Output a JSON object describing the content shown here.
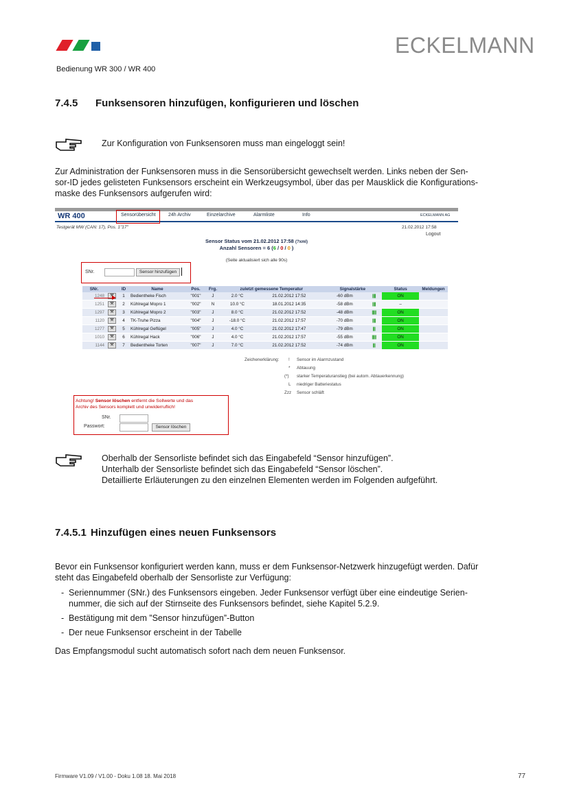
{
  "header": {
    "brand": "ECKELMANN",
    "subtitle": "Bedienung WR 300 / WR 400",
    "logo_colors": [
      "#e0202a",
      "#18a040",
      "#2060a8"
    ]
  },
  "section": {
    "number": "7.4.5",
    "title": "Funksensoren hinzufügen, konfigurieren und löschen"
  },
  "note1": "Zur Konfiguration von Funksensoren muss man eingeloggt sein!",
  "intro": [
    "Zur Administration der Funksensoren muss in die Sensorübersicht gewechselt werden. Links neben der Sen-",
    "sor-ID jedes gelisteten Funksensors erscheint ein Werkzeugsymbol, über das per Mausklick die Konfigurations-",
    "maske des Funksensors aufgerufen wird:"
  ],
  "screenshot": {
    "app": "WR 400",
    "nav": [
      "Sensorübersicht",
      "24h Archiv",
      "Einzelarchive",
      "Alarmliste",
      "Info"
    ],
    "company": "ECKELMANN AG",
    "device": "Testgerät MW (CAN: 17), Pos. 1\"17\"",
    "datetime": "21.02.2012 17:58",
    "logout": "Logout",
    "status_title": "Sensor Status vom 21.02.2012 17:58",
    "xml_link": "(?xml)",
    "count_label": "Anzahl Sensoren = 6 (",
    "count_green": "6",
    "count_sep1": " / ",
    "count_red": "0",
    "count_sep2": " / ",
    "count_orange": "0",
    "count_end": " )",
    "refresh_note": "(Seite aktualisiert sich alle 90s)",
    "add": {
      "label": "SNr.",
      "button": "Sensor hinzufügen"
    },
    "columns": [
      "SNr.",
      "ID",
      "Name",
      "Pos.",
      "Frg.",
      "zuletzt gemessene Temperatur",
      "",
      "Signalstärke",
      "",
      "Status",
      "Meldungen"
    ],
    "rows": [
      {
        "snr": "1248",
        "id": "1",
        "name": "Bedientheke Fisch",
        "pos": "\"001\"",
        "frg": "J",
        "temp": "2.0 °C",
        "time": "21.02.2012 17:52",
        "signal": "-60 dBm",
        "bars": "||||",
        "status": "ON"
      },
      {
        "snr": "1251",
        "id": "2",
        "name": "Kühlregal Mopro 1",
        "pos": "\"002\"",
        "frg": "N",
        "temp": "10.0 °C",
        "time": "18.01.2012 14:35",
        "signal": "-58 dBm",
        "bars": "||||",
        "status": "–"
      },
      {
        "snr": "1297",
        "id": "3",
        "name": "Kühlregal Mopro 2",
        "pos": "\"003\"",
        "frg": "J",
        "temp": "8.0 °C",
        "time": "21.02.2012 17:52",
        "signal": "-48 dBm",
        "bars": "|||||",
        "status": "ON"
      },
      {
        "snr": "1120",
        "id": "4",
        "name": "TK-Truhe Pizza",
        "pos": "\"004\"",
        "frg": "J",
        "temp": "-18.0 °C",
        "time": "21.02.2012 17:57",
        "signal": "-70 dBm",
        "bars": "||||",
        "status": "ON"
      },
      {
        "snr": "1277",
        "id": "5",
        "name": "Kühlregal Geflügel",
        "pos": "\"005\"",
        "frg": "J",
        "temp": "4.0 °C",
        "time": "21.02.2012 17:47",
        "signal": "-79 dBm",
        "bars": "|||",
        "status": "ON"
      },
      {
        "snr": "1010",
        "id": "6",
        "name": "Kühlregal Hack",
        "pos": "\"006\"",
        "frg": "J",
        "temp": "4.0 °C",
        "time": "21.02.2012 17:57",
        "signal": "-55 dBm",
        "bars": "|||||",
        "status": "ON"
      },
      {
        "snr": "1144",
        "id": "7",
        "name": "Bedientheke Torten",
        "pos": "\"007\"",
        "frg": "J",
        "temp": "7.0 °C",
        "time": "21.02.2012 17:52",
        "signal": "-74 dBm",
        "bars": "|||",
        "status": "ON"
      }
    ],
    "legend_title": "Zeichenerklärung:",
    "legend": [
      {
        "sym": "!",
        "text": "Sensor im Alarmzustand"
      },
      {
        "sym": "*",
        "text": "Abtauung"
      },
      {
        "sym": "(*)",
        "text": "starker Temperaturanstieg (bei autom. Abtauerkennung)"
      },
      {
        "sym": "L",
        "text": "niedriger Batteriestatus"
      },
      {
        "sym": "Zzz",
        "text": "Sensor schläft"
      }
    ],
    "delete": {
      "warn_pre": "Achtung! ",
      "warn_bold": "Sensor löschen",
      "warn_post": " entfernt die Sollwerte und das",
      "warn_line2": "Archiv des Sensors komplett und unwiderruflich!",
      "snr_label": "SNr.",
      "pw_label": "Passwort:",
      "button": "Sensor löschen"
    }
  },
  "note2": [
    "Oberhalb der Sensorliste befindet sich das Eingabefeld “Sensor hinzufügen”.",
    "Unterhalb der Sensorliste befindet sich das Eingabefeld “Sensor löschen”.",
    "Detaillierte Erläuterungen zu den einzelnen Elementen werden im Folgenden aufgeführt."
  ],
  "subsection": {
    "number": "7.4.5.1",
    "title": "Hinzufügen eines neuen Funksensors"
  },
  "para2": [
    "Bevor ein Funksensor konfiguriert werden kann, muss er dem Funksensor-Netzwerk hinzugefügt werden. Dafür",
    "steht das Eingabefeld oberhalb der Sensorliste zur Verfügung:"
  ],
  "steps": [
    [
      "Seriennummer (SNr.) des Funksensors eingeben. Jeder Funksensor verfügt über eine eindeutige Serien-",
      "nummer, die sich auf der Stirnseite des Funksensors befindet, siehe Kapitel 5.2.9."
    ],
    [
      "Bestätigung mit dem ”Sensor hinzufügen”-Button"
    ],
    [
      "Der neue Funksensor erscheint in der Tabelle"
    ]
  ],
  "closing": "Das Empfangsmodul sucht automatisch sofort nach dem neuen Funksensor.",
  "footer": {
    "left": "Firmware V1.09 / V1.00 - Doku 1.08   18. Mai 2018",
    "page": "77"
  }
}
